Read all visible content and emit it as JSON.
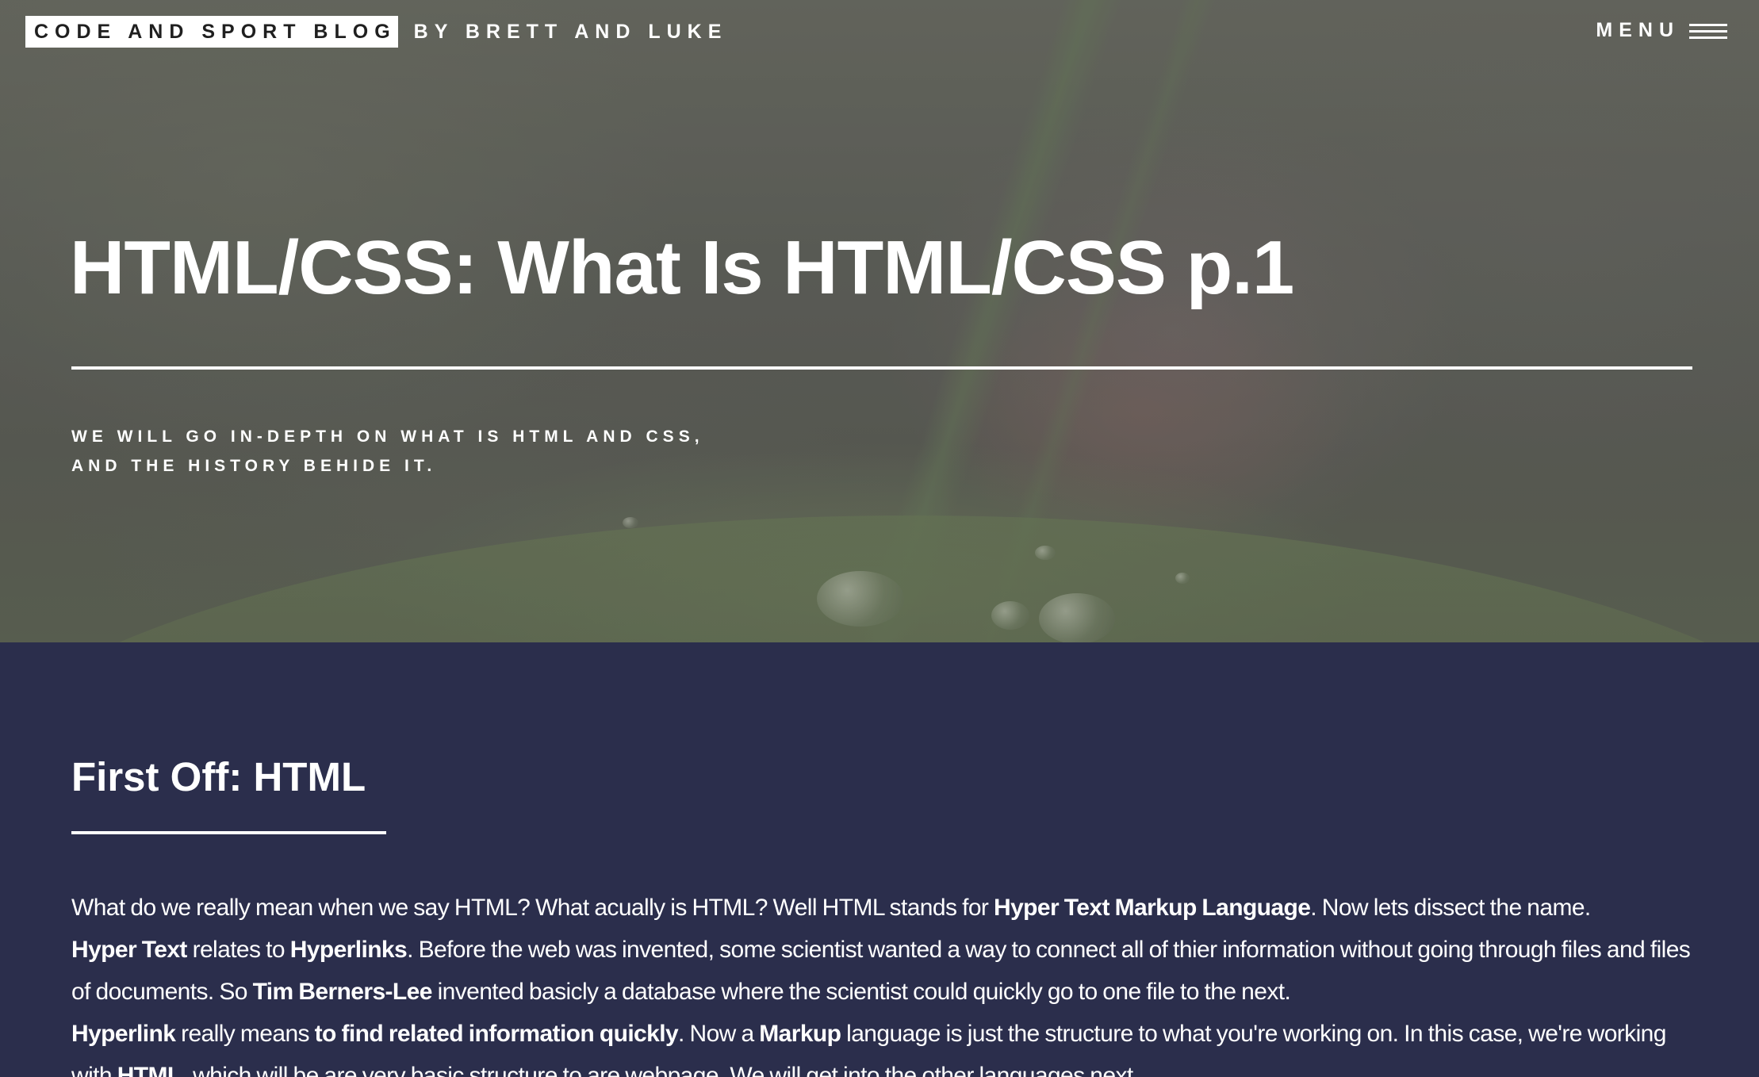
{
  "header": {
    "blog_title": "CODE AND SPORT BLOG",
    "byline": "BY BRETT AND LUKE",
    "menu_label": "MENU",
    "menu_icon": "hamburger-icon"
  },
  "hero": {
    "title": "HTML/CSS: What Is HTML/CSS p.1",
    "subtitle_line1": "WE WILL GO IN-DEPTH ON WHAT IS HTML AND CSS,",
    "subtitle_line2": "AND THE HISTORY BEHIDE IT."
  },
  "content": {
    "heading": "First Off: HTML",
    "paragraph": {
      "s1": "What do we really mean when we say HTML? What acually is HTML? Well HTML stands for ",
      "b1": "Hyper Text Markup Language",
      "s2": ". Now lets dissect the name.",
      "b2": "Hyper Text",
      "s3": " relates to ",
      "b3": "Hyperlinks",
      "s4": ". Before the web was invented, some scientist wanted a way to connect all of thier information without going through files and files of documents. So ",
      "b4": "Tim Berners-Lee",
      "s5": " invented basicly a database where the scientist could quickly go to one file to the next.",
      "b5": "Hyperlink",
      "s6": " really means ",
      "b6": "to find related information quickly",
      "s7": ". Now a ",
      "b7": "Markup",
      "s8": " language is just the structure to what you're working on. In this case, we're working with ",
      "b8": "HTML",
      "s9": ", which will be are very basic structure to are webpage. We will get into the other languages next."
    }
  },
  "colors": {
    "content_background": "#2b2e4c",
    "text": "#ffffff",
    "logo_background": "#ffffff",
    "logo_text": "#1f1f1f"
  }
}
